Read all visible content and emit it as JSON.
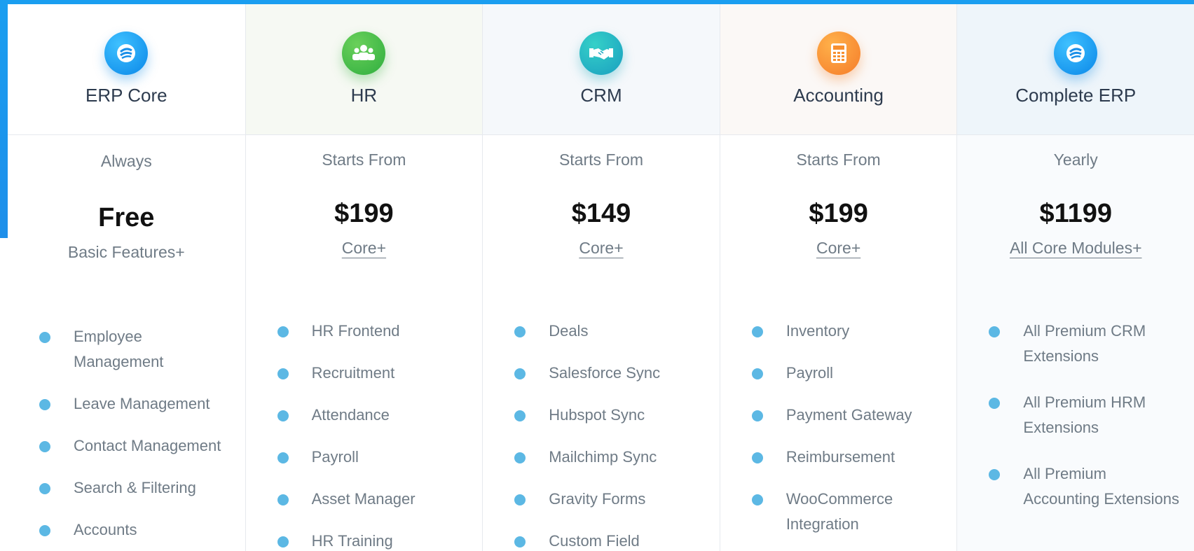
{
  "colors": {
    "accent": "#1e9af0",
    "bullet": "#5cb8e4",
    "text": "#6f7b86",
    "heading": "#2d3b4e"
  },
  "plans": [
    {
      "name": "ERP Core",
      "icon": "erp-logo-icon",
      "subhead": "Always",
      "price": "Free",
      "note": "Basic Features+",
      "features": [
        "Employee Management",
        "Leave Management",
        "Contact Management",
        "Search & Filtering",
        "Accounts"
      ]
    },
    {
      "name": "HR",
      "icon": "team-icon",
      "subhead": "Starts From",
      "price": "$199",
      "note": "Core+",
      "features": [
        "HR Frontend",
        "Recruitment",
        "Attendance",
        "Payroll",
        "Asset Manager",
        "HR Training"
      ]
    },
    {
      "name": "CRM",
      "icon": "handshake-icon",
      "subhead": "Starts From",
      "price": "$149",
      "note": "Core+",
      "features": [
        "Deals",
        "Salesforce Sync",
        "Hubspot Sync",
        "Mailchimp Sync",
        "Gravity Forms",
        "Custom Field"
      ]
    },
    {
      "name": "Accounting",
      "icon": "calculator-icon",
      "subhead": "Starts From",
      "price": "$199",
      "note": "Core+",
      "features": [
        "Inventory",
        "Payroll",
        "Payment Gateway",
        "Reimbursement",
        "WooCommerce Integration"
      ]
    },
    {
      "name": "Complete ERP",
      "icon": "erp-logo-icon",
      "subhead": "Yearly",
      "price": "$1199",
      "note": "All Core Modules+",
      "features": [
        "All Premium CRM Extensions",
        "All Premium HRM Extensions",
        "All Premium Accounting Extensions"
      ]
    }
  ]
}
